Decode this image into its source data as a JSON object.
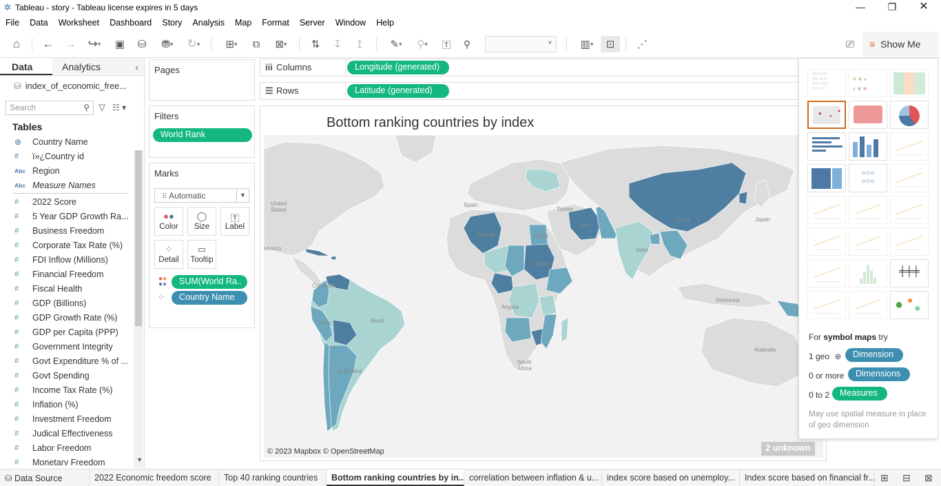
{
  "window": {
    "title": "Tableau - story - Tableau license expires in 5 days"
  },
  "menu": [
    "File",
    "Data",
    "Worksheet",
    "Dashboard",
    "Story",
    "Analysis",
    "Map",
    "Format",
    "Server",
    "Window",
    "Help"
  ],
  "toolbar": {
    "show_me_label": "Show Me"
  },
  "data_pane": {
    "tab_data": "Data",
    "tab_analytics": "Analytics",
    "datasource": "index_of_economic_free...",
    "search_placeholder": "Search",
    "tables_label": "Tables",
    "dimensions": [
      {
        "icon": "globe-icon",
        "label": "Country Name"
      },
      {
        "icon": "hash-icon",
        "label": "ï»¿Country id"
      },
      {
        "icon": "abc-icon",
        "label": "Region"
      },
      {
        "icon": "abc-icon",
        "label": "Measure Names"
      }
    ],
    "measures": [
      "2022 Score",
      "5 Year GDP Growth Ra...",
      "Business Freedom",
      "Corporate Tax Rate (%)",
      "FDI Inflow (Millions)",
      "Financial Freedom",
      "Fiscal Health",
      "GDP (Billions)",
      "GDP Growth Rate (%)",
      "GDP per Capita (PPP)",
      "Government Integrity",
      "Govt Expenditure % of ...",
      "Govt Spending",
      "Income Tax Rate (%)",
      "Inflation (%)",
      "Investment Freedom",
      "Judical Effectiveness",
      "Labor Freedom",
      "Monetary Freedom"
    ]
  },
  "cards": {
    "pages_title": "Pages",
    "filters_title": "Filters",
    "filter_pill": "World Rank",
    "marks_title": "Marks",
    "mark_type": "Automatic",
    "mark_buttons": [
      "Color",
      "Size",
      "Label",
      "Detail",
      "Tooltip"
    ],
    "mark_pills": [
      {
        "icon": "color-dots-icon",
        "label": "SUM(World Ra.."
      },
      {
        "icon": "detail-dots-icon",
        "label": "Country Name"
      }
    ]
  },
  "shelves": {
    "columns_label": "Columns",
    "columns_pill": "Longitude (generated)",
    "rows_label": "Rows",
    "rows_pill": "Latitude (generated)"
  },
  "view": {
    "title": "Bottom ranking countries by index",
    "credit": "© 2023 Mapbox © OpenStreetMap",
    "unknown": "2 unknown",
    "map_labels": [
      "United States",
      "Spain",
      "Turkey",
      "China",
      "Japan",
      "Iran",
      "India",
      "Colombia",
      "Brazil",
      "Peru",
      "Angola",
      "South Africa",
      "Australia",
      "Indonesia",
      "Mexico",
      "Algeria",
      "Egypt",
      "Sudan",
      "Argentina"
    ],
    "colors": {
      "dark": "#4e7fa0",
      "mid": "#6ea8be",
      "light": "#a9d4d2",
      "land": "#dcdcdc",
      "water": "#f2f2f2"
    }
  },
  "show_me": {
    "hint_prefix": "For ",
    "hint_bold": "symbol maps",
    "hint_suffix": " try",
    "req1_text": "1 geo",
    "req1_pill": "Dimension",
    "req2_text": "0 or more",
    "req2_pill": "Dimensions",
    "req3_text": "0 to 2",
    "req3_pill": "Measures",
    "note": "May use spatial measure in place of geo dimension"
  },
  "tabs": {
    "datasource": "Data Source",
    "sheets": [
      "2022 Economic freedom score",
      "Top 40 ranking countries",
      "Bottom ranking countries by in...",
      "correlation between inflation & u...",
      "index score based on unemploy...",
      "Index score based on financial fr..."
    ]
  }
}
